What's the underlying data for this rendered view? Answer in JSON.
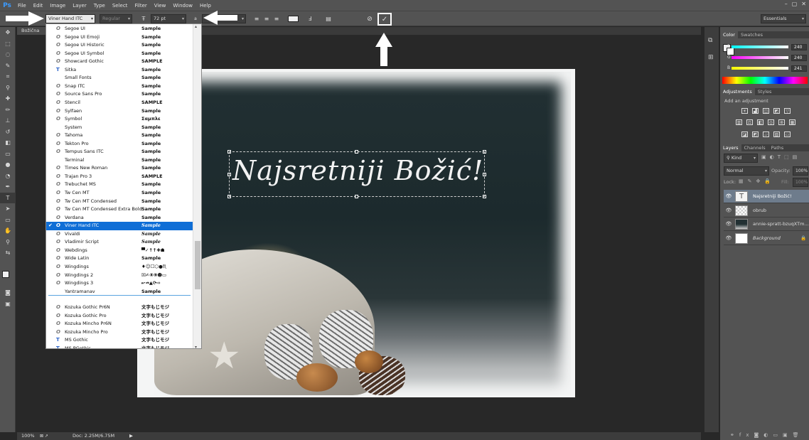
{
  "app": {
    "logo": "Ps"
  },
  "menu": [
    "File",
    "Edit",
    "Image",
    "Layer",
    "Type",
    "Select",
    "Filter",
    "View",
    "Window",
    "Help"
  ],
  "window_controls": [
    "–",
    "▢",
    "✕"
  ],
  "options": {
    "font_family": "Viner Hand ITC",
    "font_style": "Regular",
    "font_size": "72 pt",
    "antialias": "a",
    "workspace": "Essentials",
    "commit_symbol": "✓",
    "cancel_symbol": "⃠"
  },
  "document": {
    "tab": "Božična",
    "zoom": "100%",
    "doc_info": "Doc: 2.25M/6.75M",
    "headline": "Najsretniji Božić!"
  },
  "font_list": [
    {
      "name": "Segoe UI",
      "sample": "Sample",
      "icon": "O"
    },
    {
      "name": "Segoe UI Emoji",
      "sample": "Sample",
      "icon": "O"
    },
    {
      "name": "Segoe UI Historic",
      "sample": "Sample",
      "icon": "O"
    },
    {
      "name": "Segoe UI Symbol",
      "sample": "Sample",
      "icon": "O"
    },
    {
      "name": "Showcard Gothic",
      "sample": "SAMPLE",
      "icon": "O"
    },
    {
      "name": "Sitka",
      "sample": "Sample",
      "icon": "T"
    },
    {
      "name": "Small Fonts",
      "sample": "Sample",
      "icon": ""
    },
    {
      "name": "Snap ITC",
      "sample": "Sample",
      "icon": "O"
    },
    {
      "name": "Source Sans Pro",
      "sample": "Sample",
      "icon": "O"
    },
    {
      "name": "Stencil",
      "sample": "SAMPLE",
      "icon": "O"
    },
    {
      "name": "Sylfaen",
      "sample": "Sample",
      "icon": "O"
    },
    {
      "name": "Symbol",
      "sample": "Σαμπλε",
      "icon": "O"
    },
    {
      "name": "System",
      "sample": "Sample",
      "icon": ""
    },
    {
      "name": "Tahoma",
      "sample": "Sample",
      "icon": "O"
    },
    {
      "name": "Tekton Pro",
      "sample": "Sample",
      "icon": "O"
    },
    {
      "name": "Tempus Sans ITC",
      "sample": "Sample",
      "icon": "O"
    },
    {
      "name": "Terminal",
      "sample": "Sample",
      "icon": ""
    },
    {
      "name": "Times New Roman",
      "sample": "Sample",
      "icon": "O"
    },
    {
      "name": "Trajan Pro 3",
      "sample": "SAMPLE",
      "icon": "O"
    },
    {
      "name": "Trebuchet MS",
      "sample": "Sample",
      "icon": "O"
    },
    {
      "name": "Tw Cen MT",
      "sample": "Sample",
      "icon": "O"
    },
    {
      "name": "Tw Cen MT Condensed",
      "sample": "Sample",
      "icon": "O"
    },
    {
      "name": "Tw Cen MT Condensed Extra Bold",
      "sample": "Sample",
      "icon": "O"
    },
    {
      "name": "Verdana",
      "sample": "Sample",
      "icon": "O"
    },
    {
      "name": "Viner Hand ITC",
      "sample": "Sample",
      "icon": "O",
      "selected": true
    },
    {
      "name": "Vivaldi",
      "sample": "Sample",
      "icon": "O"
    },
    {
      "name": "Vladimir Script",
      "sample": "Sample",
      "icon": "O"
    },
    {
      "name": "Webdings",
      "sample": "▀✓↑↑✚☗",
      "icon": "O"
    },
    {
      "name": "Wide Latin",
      "sample": "Sample",
      "icon": "O"
    },
    {
      "name": "Wingdings",
      "sample": "♦☺☐⬡●♏",
      "icon": "O"
    },
    {
      "name": "Wingdings 2",
      "sample": "☒✍⑧⑨☻▭",
      "icon": "O"
    },
    {
      "name": "Wingdings 3",
      "sample": "↜↛▲⟳⇨",
      "icon": "O"
    },
    {
      "name": "Yantramanav",
      "sample": "Sample",
      "icon": ""
    },
    {
      "name": "Kozuka Gothic Pr6N",
      "sample": "文字もじモジ",
      "icon": "O"
    },
    {
      "name": "Kozuka Gothic Pro",
      "sample": "文字もじモジ",
      "icon": "O"
    },
    {
      "name": "Kozuka Mincho Pr6N",
      "sample": "文字もじモジ",
      "icon": "O"
    },
    {
      "name": "Kozuka Mincho Pro",
      "sample": "文字もじモジ",
      "icon": "O"
    },
    {
      "name": "MS Gothic",
      "sample": "文字もじモジ",
      "icon": "T"
    },
    {
      "name": "MS PGothic",
      "sample": "文字もじモジ",
      "icon": "T"
    }
  ],
  "color_panel": {
    "tabs": [
      "Color",
      "Swatches"
    ],
    "r": {
      "label": "R",
      "value": "240"
    },
    "g": {
      "label": "G",
      "value": "240"
    },
    "b": {
      "label": "B",
      "value": "241"
    }
  },
  "adjustments_panel": {
    "tabs": [
      "Adjustments",
      "Styles"
    ],
    "hint": "Add an adjustment"
  },
  "layers_panel": {
    "tabs": [
      "Layers",
      "Channels",
      "Paths"
    ],
    "filter": "Kind",
    "blend": "Normal",
    "opacity_label": "Opacity:",
    "opacity": "100%",
    "lock_label": "Lock:",
    "fill_label": "Fill:",
    "fill": "100%",
    "layers": [
      {
        "name": "Najsretniji Božić!",
        "kind": "text",
        "active": true
      },
      {
        "name": "obrub",
        "kind": "pixel"
      },
      {
        "name": "annie-spratt-bzuqXTm...",
        "kind": "photo"
      },
      {
        "name": "Background",
        "kind": "background"
      }
    ]
  },
  "colors": {
    "accent": "#0f6ed6",
    "ui_bg": "#535353",
    "canvas_bg": "#282828"
  }
}
